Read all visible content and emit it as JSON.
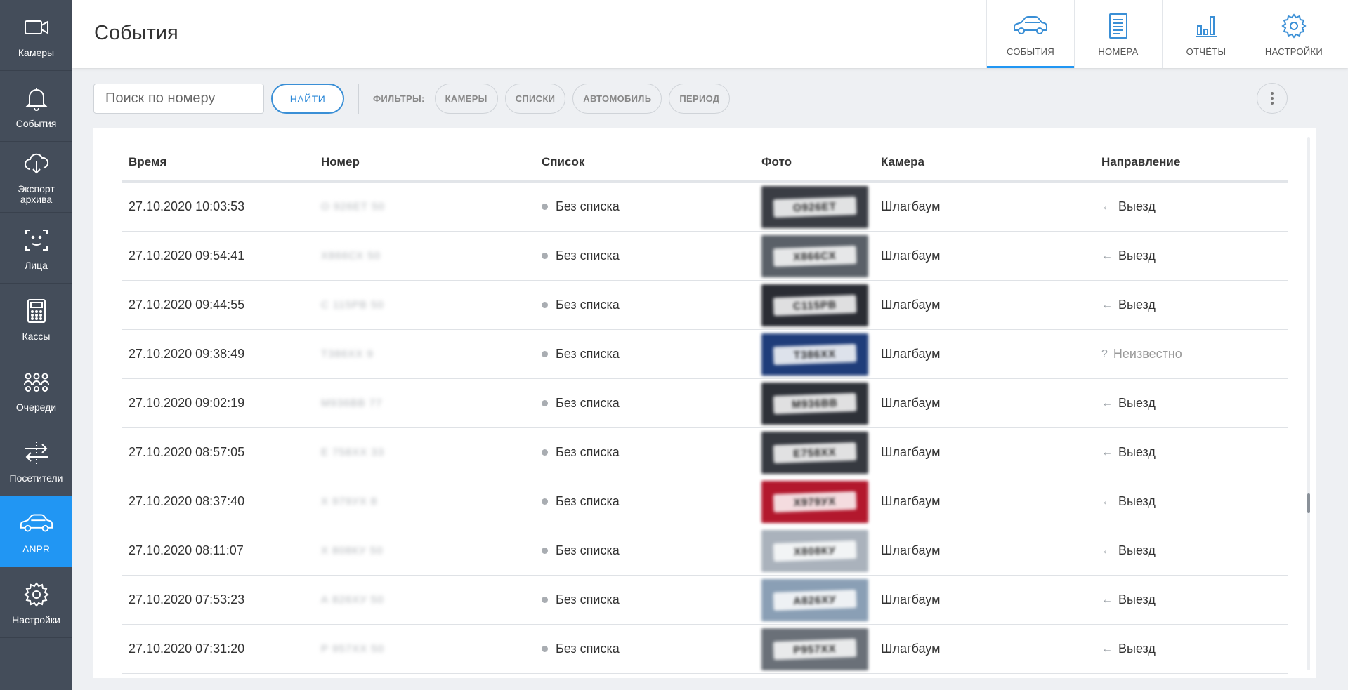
{
  "sidebar": {
    "items": [
      {
        "label": "Камеры",
        "icon": "camera-icon"
      },
      {
        "label": "События",
        "icon": "bell-icon"
      },
      {
        "label": "Экспорт архива",
        "icon": "cloud-download-icon"
      },
      {
        "label": "Лица",
        "icon": "face-scan-icon"
      },
      {
        "label": "Кассы",
        "icon": "cash-register-icon"
      },
      {
        "label": "Очереди",
        "icon": "queue-people-icon"
      },
      {
        "label": "Посетители",
        "icon": "visitors-arrows-icon"
      },
      {
        "label": "ANPR",
        "icon": "car-icon",
        "active": true
      },
      {
        "label": "Настройки",
        "icon": "gear-icon"
      }
    ]
  },
  "header": {
    "title": "События",
    "tabs": [
      {
        "label": "СОБЫТИЯ",
        "icon": "car-icon",
        "active": true
      },
      {
        "label": "НОМЕРА",
        "icon": "document-icon"
      },
      {
        "label": "ОТЧЁТЫ",
        "icon": "bar-chart-icon"
      },
      {
        "label": "НАСТРОЙКИ",
        "icon": "gear-icon"
      }
    ]
  },
  "toolbar": {
    "search_placeholder": "Поиск по номеру",
    "search_value": "",
    "help": "?",
    "find_label": "НАЙТИ",
    "filters_label": "ФИЛЬТРЫ:",
    "filters": [
      "КАМЕРЫ",
      "СПИСКИ",
      "АВТОМОБИЛЬ",
      "ПЕРИОД"
    ]
  },
  "table": {
    "columns": {
      "time": "Время",
      "number": "Номер",
      "list": "Список",
      "photo": "Фото",
      "camera": "Камера",
      "direction": "Направление"
    },
    "rows": [
      {
        "time": "27.10.2020 10:03:53",
        "number": "О 926ЕТ 50",
        "list": "Без списка",
        "camera": "Шлагбаум",
        "direction": "Выезд",
        "plate_color": "#3a3d44",
        "plate_text": "О926ЕТ"
      },
      {
        "time": "27.10.2020 09:54:41",
        "number": "Х866СХ 50",
        "list": "Без списка",
        "camera": "Шлагбаум",
        "direction": "Выезд",
        "plate_color": "#5a6068",
        "plate_text": "Х866СХ"
      },
      {
        "time": "27.10.2020 09:44:55",
        "number": "С 115РВ 50",
        "list": "Без списка",
        "camera": "Шлагбаум",
        "direction": "Выезд",
        "plate_color": "#2a2c33",
        "plate_text": "С115РВ"
      },
      {
        "time": "27.10.2020 09:38:49",
        "number": "Т386ХХ 9",
        "list": "Без списка",
        "camera": "Шлагбаум",
        "direction": "Неизвестно",
        "unknown": true,
        "plate_color": "#1f3d7a",
        "plate_text": "Т386ХХ"
      },
      {
        "time": "27.10.2020 09:02:19",
        "number": "М936ВВ 77",
        "list": "Без списка",
        "camera": "Шлагбаум",
        "direction": "Выезд",
        "plate_color": "#2e3138",
        "plate_text": "М936ВВ"
      },
      {
        "time": "27.10.2020 08:57:05",
        "number": "Е 758ХХ 33",
        "list": "Без списка",
        "camera": "Шлагбаум",
        "direction": "Выезд",
        "plate_color": "#363940",
        "plate_text": "Е758ХХ"
      },
      {
        "time": "27.10.2020 08:37:40",
        "number": "Х 979УХ 8",
        "list": "Без списка",
        "camera": "Шлагбаум",
        "direction": "Выезд",
        "plate_color": "#b3182d",
        "plate_text": "Х979УХ"
      },
      {
        "time": "27.10.2020 08:11:07",
        "number": "Х 808КУ 50",
        "list": "Без списка",
        "camera": "Шлагбаум",
        "direction": "Выезд",
        "plate_color": "#aab2bc",
        "plate_text": "Х808КУ"
      },
      {
        "time": "27.10.2020 07:53:23",
        "number": "А 826ХУ 50",
        "list": "Без списка",
        "camera": "Шлагбаум",
        "direction": "Выезд",
        "plate_color": "#8a9fb5",
        "plate_text": "А826ХУ"
      },
      {
        "time": "27.10.2020 07:31:20",
        "number": "Р 957ХХ 50",
        "list": "Без списка",
        "camera": "Шлагбаум",
        "direction": "Выезд",
        "plate_color": "#6a7078",
        "plate_text": "Р957ХХ"
      }
    ]
  },
  "colors": {
    "accent": "#2196f3",
    "sidebar_bg": "#444d5a"
  }
}
